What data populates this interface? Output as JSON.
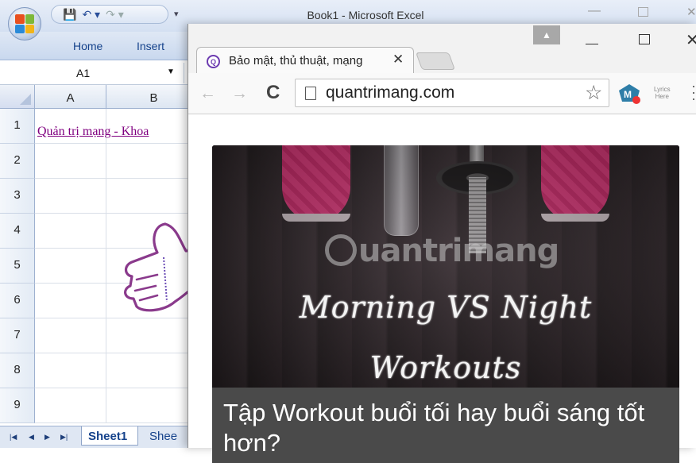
{
  "excel": {
    "window_title": "Book1 - Microsoft Excel",
    "ribbon_tabs": [
      "Home",
      "Insert"
    ],
    "name_box": "A1",
    "columns": [
      "A",
      "B"
    ],
    "rows": [
      "1",
      "2",
      "3",
      "4",
      "5",
      "6",
      "7",
      "8",
      "9"
    ],
    "cell_a1": "Quản trị mạng - Khoa",
    "sheets": [
      "Sheet1",
      "Shee"
    ]
  },
  "chrome": {
    "tab_title": "Bảo mật, thủ thuật, mạng",
    "url": "quantrimang.com",
    "ext_lyrics_line1": "Lyrics",
    "ext_lyrics_line2": "Here",
    "card": {
      "watermark": "uantrimang",
      "hero_line1": "Morning VS Night",
      "hero_line2": "Workouts",
      "article_title": "Tập Workout buổi tối hay buổi sáng tốt hơn?"
    }
  },
  "colors": {
    "hyperlink_visited": "#800080",
    "excel_blue": "#15428b",
    "shoe_pink": "#ff3d8b"
  },
  "icons": [
    "office-button-icon",
    "save-icon",
    "undo-icon",
    "redo-icon",
    "pointing-hand-icon",
    "favicon-icon",
    "back-icon",
    "forward-icon",
    "reload-icon",
    "page-icon",
    "star-icon",
    "extension-icon",
    "menu-icon"
  ]
}
